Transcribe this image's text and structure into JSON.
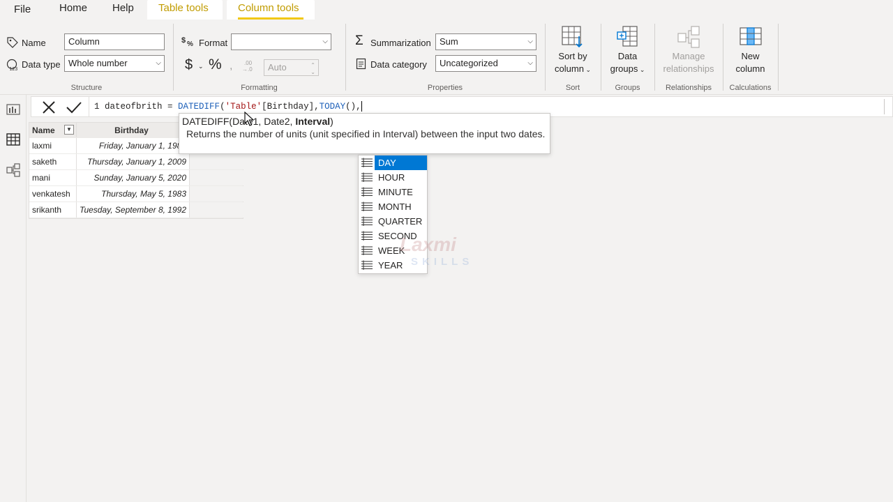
{
  "menu": {
    "file": "File",
    "home": "Home",
    "help": "Help",
    "table_tools": "Table tools",
    "column_tools": "Column tools"
  },
  "ribbon": {
    "structure": {
      "name_label": "Name",
      "name_value": "Column",
      "datatype_label": "Data type",
      "datatype_value": "Whole number",
      "group_label": "Structure"
    },
    "formatting": {
      "format_label": "Format",
      "format_value": "",
      "currency": "$",
      "percent": "%",
      "decimals_value": "Auto",
      "group_label": "Formatting"
    },
    "properties": {
      "summarization_label": "Summarization",
      "summarization_value": "Sum",
      "category_label": "Data category",
      "category_value": "Uncategorized",
      "group_label": "Properties"
    },
    "sort": {
      "btn_line1": "Sort by",
      "btn_line2": "column",
      "group_label": "Sort"
    },
    "groups": {
      "btn_line1": "Data",
      "btn_line2": "groups",
      "group_label": "Groups"
    },
    "relationships": {
      "btn_line1": "Manage",
      "btn_line2": "relationships",
      "group_label": "Relationships"
    },
    "calculations": {
      "btn_line1": "New",
      "btn_line2": "column",
      "group_label": "Calculations"
    }
  },
  "formula": {
    "line_no": "1",
    "part1": " dateofbrith = ",
    "fn1": "DATEDIFF",
    "part2": "(",
    "str1": "'Table'",
    "part3": "[Birthday],",
    "fn2": "TODAY",
    "part4": "(),"
  },
  "table": {
    "headers": [
      "Name",
      "Birthday"
    ],
    "rows": [
      [
        "laxmi",
        "Friday, January 1, 1982"
      ],
      [
        "saketh",
        "Thursday, January 1, 2009"
      ],
      [
        "mani",
        "Sunday, January 5, 2020"
      ],
      [
        "venkatesh",
        "Thursday, May 5, 1983"
      ],
      [
        "srikanth",
        "Tuesday, September 8, 1992"
      ]
    ]
  },
  "tooltip": {
    "sig_prefix": "DATEDIFF(Date1, Date2, ",
    "sig_bold": "Interval",
    "sig_suffix": ")",
    "description": "Returns the number of units (unit specified in Interval) between the input two dates."
  },
  "autocomplete": {
    "items": [
      "DAY",
      "HOUR",
      "MINUTE",
      "MONTH",
      "QUARTER",
      "SECOND",
      "WEEK",
      "YEAR"
    ],
    "selected_index": 0
  },
  "watermark": {
    "line1": "Laxmi",
    "line2": "SKILLS"
  },
  "colors": {
    "accent": "#c19c00",
    "tab_underline": "#f2c811",
    "selection": "#0078d4",
    "function": "#1c5fb8"
  }
}
